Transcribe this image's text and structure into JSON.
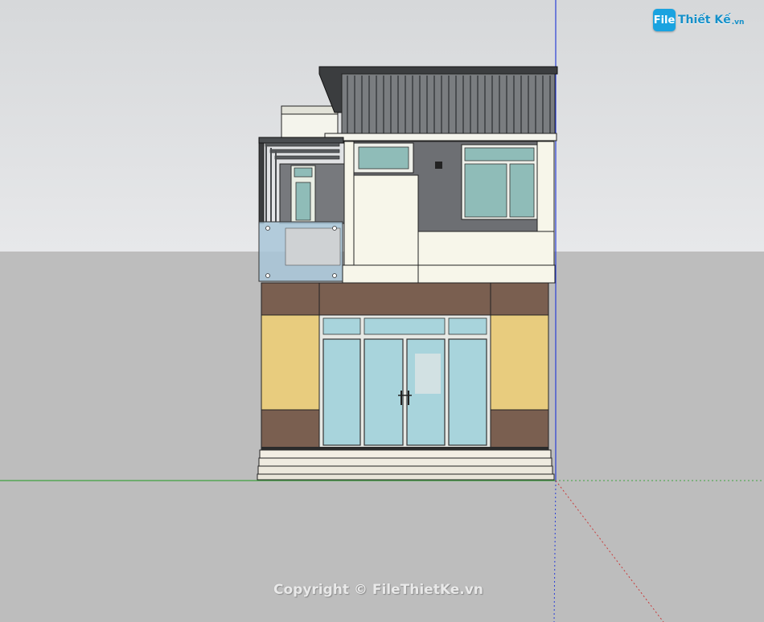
{
  "app": {
    "logo": {
      "mark": "File",
      "name": "Thiết Kế",
      "suffix": ".vn"
    },
    "watermark": "Copyright © FileThietKe.vn"
  },
  "colors": {
    "sky": "#dcdedf",
    "ground": "#bdbdbd",
    "green_axis": "#3fa33f",
    "blue_axis": "#2a3fd6",
    "red_axis": "#c83b3b",
    "stone": "#7a5f50",
    "yellow_stone": "#e8cc7e",
    "cream_wall": "#f7f6ea",
    "dark_roof": "#3b3d3f",
    "glass": "#a8d4dc",
    "grey_tile": "#6d6f73"
  },
  "icons": {
    "axes": "axis-lines-icon",
    "door_handle": "door-handle-icon"
  }
}
